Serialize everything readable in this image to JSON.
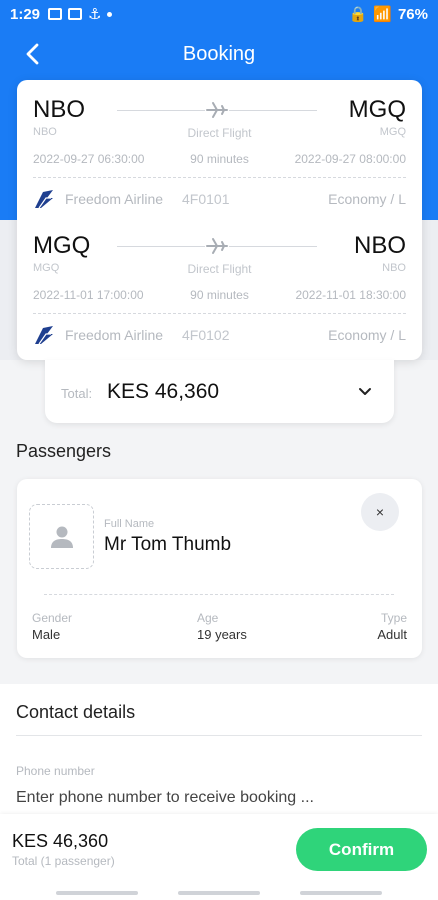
{
  "status_bar": {
    "time": "1:29",
    "battery": "76%"
  },
  "header": {
    "title": "Booking"
  },
  "flights": [
    {
      "from_code": "NBO",
      "from_sub": "NBO",
      "to_code": "MGQ",
      "to_sub": "MGQ",
      "type": "Direct Flight",
      "departure": "2022-09-27 06:30:00",
      "duration": "90 minutes",
      "arrival": "2022-09-27 08:00:00",
      "airline": "Freedom Airline",
      "flight_number": "4F0101",
      "cabin": "Economy / L"
    },
    {
      "from_code": "MGQ",
      "from_sub": "MGQ",
      "to_code": "NBO",
      "to_sub": "NBO",
      "type": "Direct Flight",
      "departure": "2022-11-01 17:00:00",
      "duration": "90 minutes",
      "arrival": "2022-11-01 18:30:00",
      "airline": "Freedom Airline",
      "flight_number": "4F0102",
      "cabin": "Economy / L"
    }
  ],
  "total": {
    "label": "Total:",
    "amount": "KES 46,360"
  },
  "passengers": {
    "title": "Passengers",
    "list": [
      {
        "full_name_label": "Full Name",
        "full_name": "Mr Tom Thumb",
        "remove": "×",
        "gender_label": "Gender",
        "gender": "Male",
        "age_label": "Age",
        "age": "19 years",
        "type_label": "Type",
        "type": "Adult"
      }
    ]
  },
  "contact": {
    "title": "Contact details",
    "phone_label": "Phone number",
    "phone_placeholder": "Enter phone number to receive booking ..."
  },
  "footer": {
    "total": "KES 46,360",
    "sub": "Total (1 passenger)",
    "confirm_label": "Confirm"
  },
  "colors": {
    "primary": "#1a7cf5",
    "confirm": "#2fd47a"
  }
}
